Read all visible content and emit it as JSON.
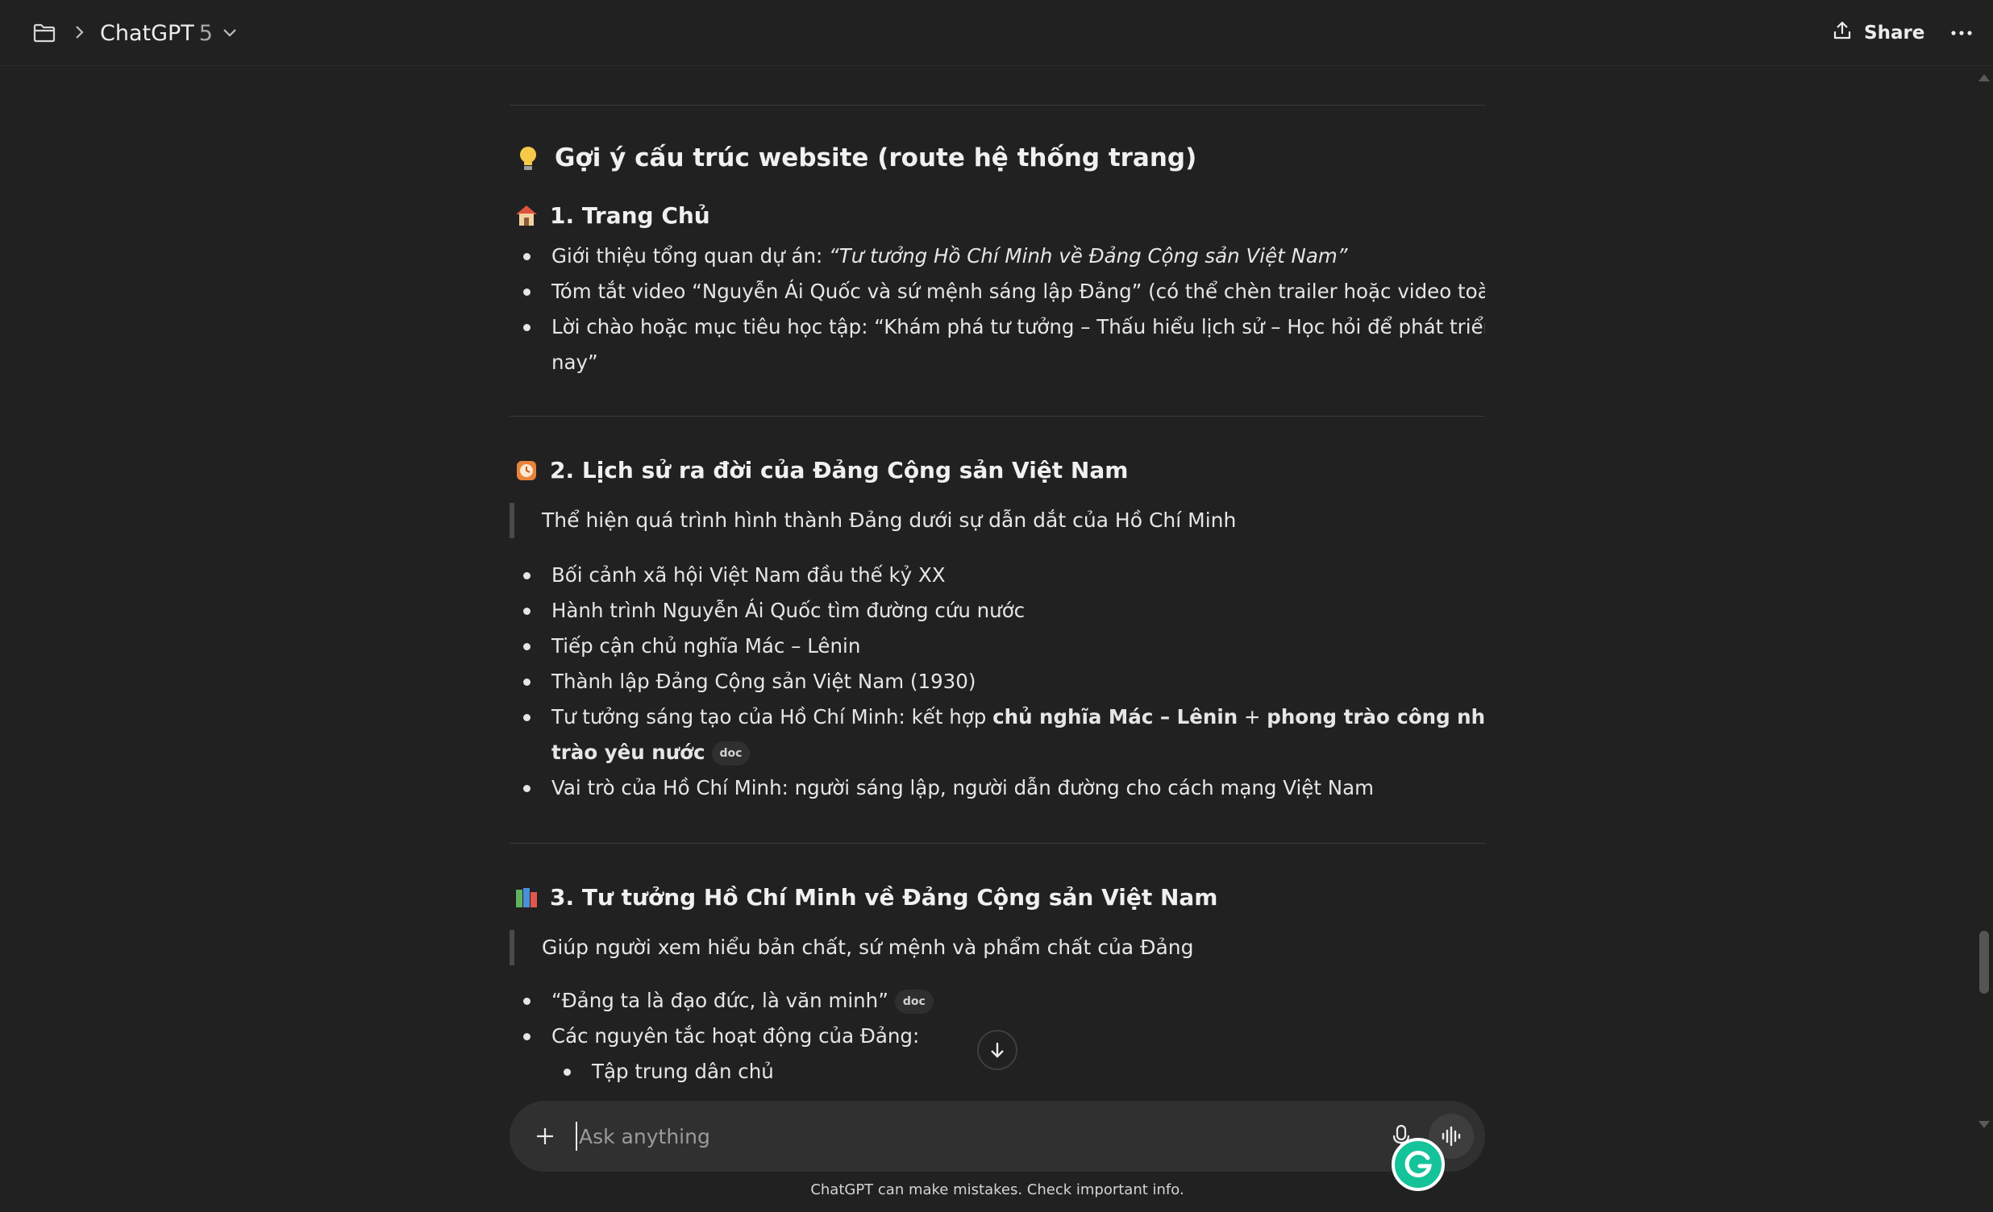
{
  "header": {
    "model_name": "ChatGPT",
    "model_version": "5",
    "share_label": "Share",
    "icons": [
      "folder-icon",
      "chevron-right-icon",
      "chevron-down-icon",
      "share-icon",
      "more-icon"
    ]
  },
  "content": {
    "main_heading": "Gợi ý cấu trúc website (route hệ thống trang)",
    "section1": {
      "title": "1. Trang Chủ",
      "items": {
        "i0_prefix": "Giới thiệu tổng quan dự án: ",
        "i0_italic": "“Tư tưởng Hồ Chí Minh về Đảng Cộng sản Việt Nam”",
        "i1": "Tóm tắt video “Nguyễn Ái Quốc và sứ mệnh sáng lập Đảng” (có thể chèn trailer hoặc video toàn phần)",
        "i2_line1": "Lời chào hoặc mục tiêu học tập: “Khám phá tư tưởng – Thấu hiểu lịch sử – Học hỏi để phát triển hiện",
        "i2_line2": "nay”"
      }
    },
    "section2": {
      "title": "2. Lịch sử ra đời của Đảng Cộng sản Việt Nam",
      "quote": "Thể hiện quá trình hình thành Đảng dưới sự dẫn dắt của Hồ Chí Minh",
      "items": {
        "i0": "Bối cảnh xã hội Việt Nam đầu thế kỷ XX",
        "i1": "Hành trình Nguyễn Ái Quốc tìm đường cứu nước",
        "i2": "Tiếp cận chủ nghĩa Mác – Lênin",
        "i3": "Thành lập Đảng Cộng sản Việt Nam (1930)",
        "i4_prefix": "Tư tưởng sáng tạo của Hồ Chí Minh: kết hợp ",
        "i4_b1": "chủ nghĩa Mác – Lênin",
        "i4_plus1": " + ",
        "i4_b2": "phong trào công nhân",
        "i4_plus2": " + ",
        "i4_b3": "phong",
        "i4_line2_b": "trào yêu nước",
        "i4_chip": "doc",
        "i5": "Vai trò của Hồ Chí Minh: người sáng lập, người dẫn đường cho cách mạng Việt Nam"
      }
    },
    "section3": {
      "title": "3. Tư tưởng Hồ Chí Minh về Đảng Cộng sản Việt Nam",
      "quote": "Giúp người xem hiểu bản chất, sứ mệnh và phẩm chất của Đảng",
      "items": {
        "i0": "“Đảng ta là đạo đức, là văn minh”",
        "i0_chip": "doc",
        "i1": "Các nguyên tắc hoạt động của Đảng:",
        "i1_sub0": "Tập trung dân chủ"
      }
    }
  },
  "composer": {
    "placeholder": "Ask anything",
    "value": ""
  },
  "disclaimer": "ChatGPT can make mistakes. Check important info.",
  "colors": {
    "background": "#212121",
    "composer": "#303030",
    "grammarly": "#15c39a",
    "text": "#ececec"
  }
}
